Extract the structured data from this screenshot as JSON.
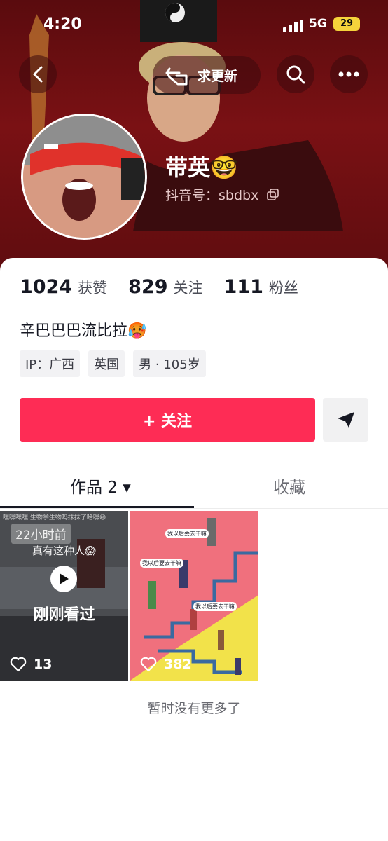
{
  "status_bar": {
    "time": "4:20",
    "network": "5G",
    "battery": "29"
  },
  "header": {
    "update_request_label": "求更新"
  },
  "profile": {
    "name": "带英",
    "name_emoji": "🤓",
    "douyin_id": "抖音号：sbdbx",
    "stats": [
      {
        "value": "1024",
        "label": "获赞"
      },
      {
        "value": "829",
        "label": "关注"
      },
      {
        "value": "111",
        "label": "粉丝"
      }
    ],
    "bio": "辛巴巴巴流比拉🥵",
    "tags": [
      "IP：广西",
      "英国",
      "男 · 105岁"
    ]
  },
  "actions": {
    "follow_label": "+ 关注"
  },
  "tabs": [
    {
      "label": "作品 2 ▾",
      "active": true
    },
    {
      "label": "收藏",
      "active": false
    }
  ],
  "videos": [
    {
      "time_badge": "22小时前",
      "top_caption": "嘿嘿嘿嘿 生物学生物吗抹抹了哈嘿😅",
      "caption": "真有这种人😱",
      "watched_label": "刚刚看过",
      "likes": "13"
    },
    {
      "likes": "382",
      "bubble_text": "我以后要去干嘛"
    }
  ],
  "footer_note": "暂时没有更多了",
  "colors": {
    "accent": "#fe2c55",
    "hero_bg": "#6e0f12"
  }
}
